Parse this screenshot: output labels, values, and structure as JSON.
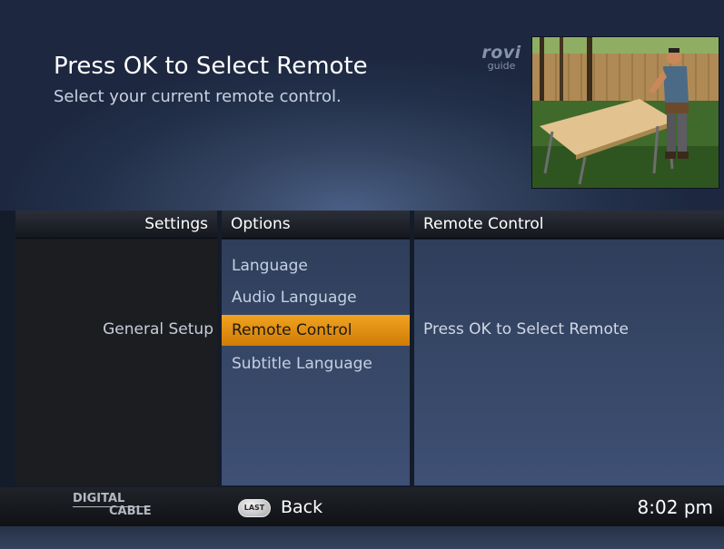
{
  "screen": {
    "title": "Press OK to Select Remote",
    "subtitle": "Select your current remote control."
  },
  "logo": {
    "brand": "rovi",
    "product": "guide"
  },
  "preview": {
    "icon": "live-tv-preview"
  },
  "columns": {
    "settings": {
      "header": "Settings",
      "items": [
        {
          "label": "General Setup"
        }
      ]
    },
    "options": {
      "header": "Options",
      "items": [
        {
          "label": "Language",
          "selected": false
        },
        {
          "label": "Audio Language",
          "selected": false
        },
        {
          "label": "Remote Control",
          "selected": true
        },
        {
          "label": "Subtitle Language",
          "selected": false
        }
      ]
    },
    "detail": {
      "header": "Remote Control",
      "text": "Press OK to Select Remote"
    }
  },
  "footer": {
    "brand_line1": "DIGITAL",
    "brand_line2": "CABLE",
    "back_button_icon_label": "LAST",
    "back_label": "Back",
    "time": "8:02 pm"
  },
  "colors": {
    "selection": "#e79212",
    "panel": "#34456a",
    "background": "#1d2840"
  }
}
